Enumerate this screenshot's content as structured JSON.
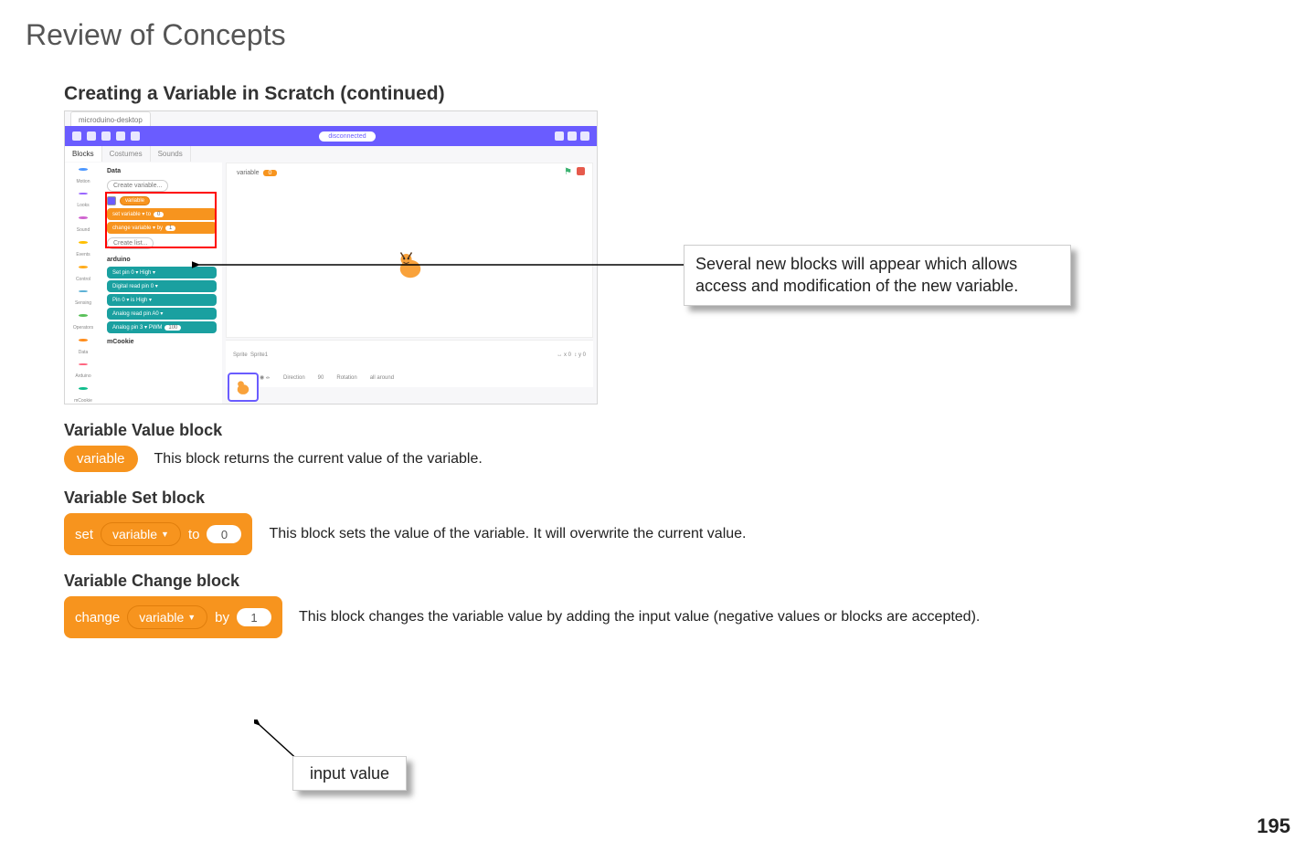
{
  "page": {
    "title": "Review of Concepts",
    "section_heading": "Creating a Variable in Scratch (continued)",
    "page_number": "195"
  },
  "callouts": {
    "new_blocks": "Several new blocks will appear which allows access and modification of the new variable.",
    "input_value": "input value"
  },
  "vvb": {
    "heading": "Variable Value block",
    "pill": "variable",
    "desc": "This block returns the current value of the variable."
  },
  "vsb": {
    "heading": "Variable Set block",
    "set": "set",
    "var": "variable",
    "to": "to",
    "val": "0",
    "desc": "This block sets the value of the variable. It will overwrite the current value."
  },
  "vcb": {
    "heading": "Variable Change block",
    "change": "change",
    "var": "variable",
    "by": "by",
    "val": "1",
    "desc": "This block changes the variable value by adding the input value (negative values or blocks are accepted)."
  },
  "shot": {
    "tab": "microduino-desktop",
    "disconnected": "disconnected",
    "tabs": {
      "blocks": "Blocks",
      "costumes": "Costumes",
      "sounds": "Sounds"
    },
    "cat_labels": {
      "motion": "Motion",
      "looks": "Looks",
      "sound": "Sound",
      "events": "Events",
      "control": "Control",
      "sensing": "Sensing",
      "operators": "Operators",
      "data": "Data",
      "arduino": "Arduino",
      "mcookie": "mCookie"
    },
    "palette": {
      "data": "Data",
      "create_var": "Create variable...",
      "variable": "variable",
      "set": "set  variable ▾  to",
      "set_v": "0",
      "change": "change  variable ▾  by",
      "change_v": "1",
      "create_list": "Create list...",
      "arduino": "arduino",
      "setpin": "Set pin  0 ▾  High ▾",
      "dread": "Digital read pin  0 ▾",
      "pinis": "Pin  0 ▾  is  High ▾",
      "aread": "Analog read pin  A0 ▾",
      "apin": "Analog pin  3 ▾  PWM",
      "apin_v": "100",
      "mcookie": "mCookie"
    },
    "hud_var": "variable",
    "hud_val": "0",
    "sprite_row": {
      "sprite": "Sprite",
      "name": "Sprite1",
      "x": "x",
      "xval": "0",
      "y": "y",
      "yval": "0",
      "show": "Show",
      "dir": "Direction",
      "dirv": "90",
      "rot": "Rotation",
      "rotv": "all around"
    }
  }
}
